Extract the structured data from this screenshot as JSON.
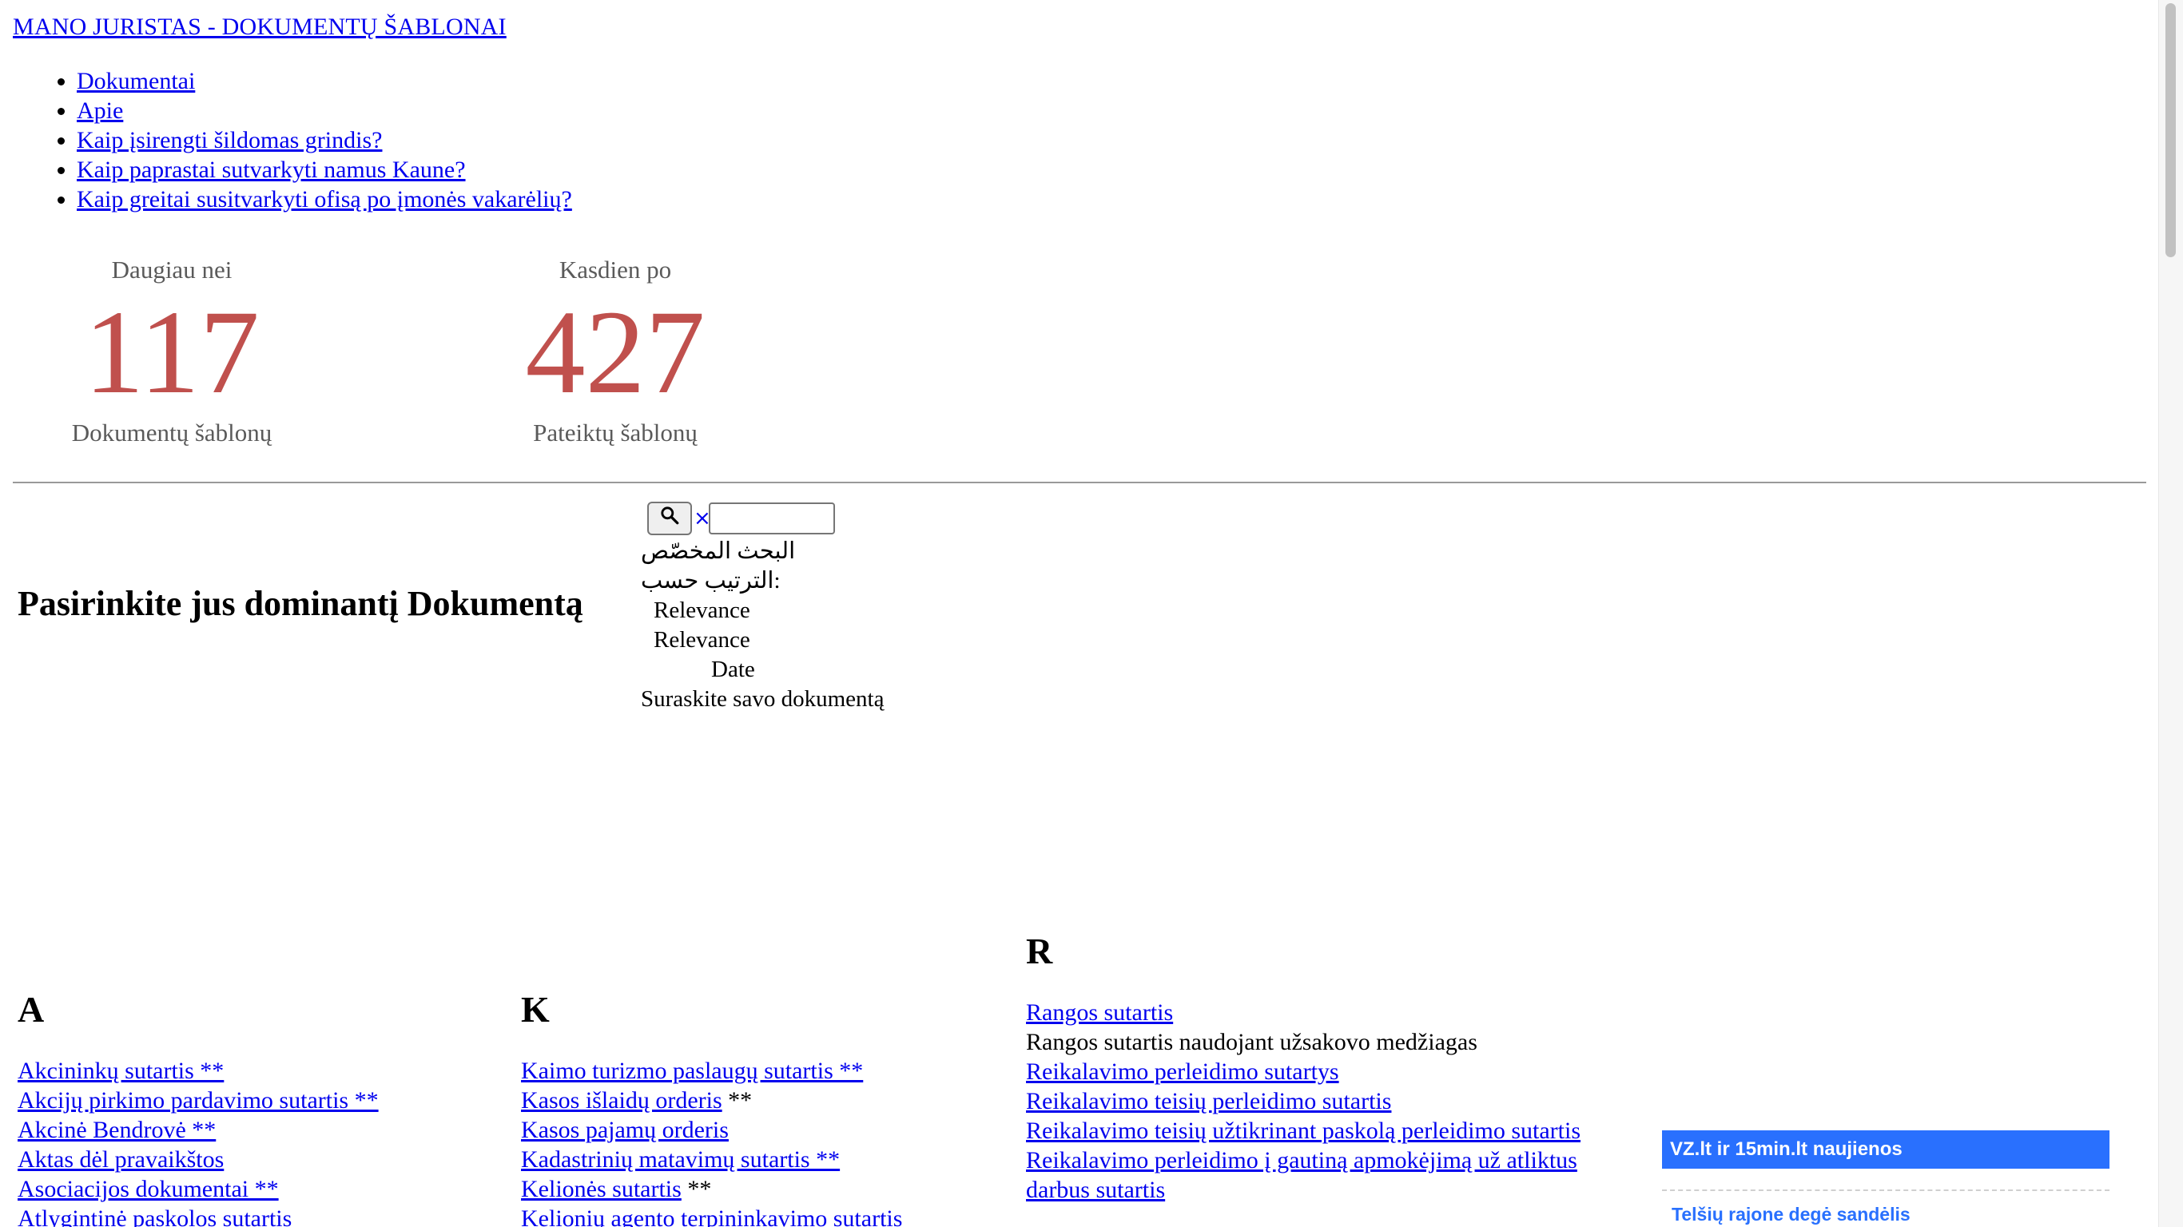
{
  "site": {
    "title": "MANO JURISTAS - DOKUMENTŲ ŠABLONAI"
  },
  "nav": {
    "items": [
      "Dokumentai",
      "Apie",
      "Kaip įsirengti šildomas grindis?",
      "Kaip paprastai sutvarkyti namus Kaune?",
      "Kaip greitai susitvarkyti ofisą po įmonės vakarėlių?"
    ]
  },
  "stats": {
    "left": {
      "top": "Daugiau nei",
      "number": "117",
      "bottom": "Dokumentų šablonų"
    },
    "right": {
      "top": "Kasdien po",
      "number": "427",
      "bottom": "Pateiktų šablonų"
    }
  },
  "page": {
    "heading": "Pasirinkite jus dominantį Dokumentą"
  },
  "search": {
    "clear_label": "×",
    "input_value": "",
    "custom_search": "البحث المخصّص",
    "sort_by": "الترتيب حسب:",
    "options": [
      "Relevance",
      "Relevance",
      "Date"
    ],
    "find_label": "Suraskite savo dokumentą",
    "icon": "search-icon"
  },
  "sections": {
    "a": {
      "letter": "A",
      "items": [
        {
          "link": "Akcininkų sutartis **",
          "suffix": ""
        },
        {
          "link": "Akcijų pirkimo pardavimo sutartis **",
          "suffix": ""
        },
        {
          "link": "Akcinė Bendrovė **",
          "suffix": ""
        },
        {
          "link": "Aktas dėl pravaikštos",
          "suffix": ""
        },
        {
          "link": "Asociacijos dokumentai **",
          "suffix": ""
        },
        {
          "link": "Atlygintinė paskolos sutartis",
          "suffix": ""
        }
      ]
    },
    "k": {
      "letter": "K",
      "items": [
        {
          "link": "Kaimo turizmo paslaugų sutartis **",
          "suffix": ""
        },
        {
          "link": "Kasos išlaidų orderis",
          "suffix": " **"
        },
        {
          "link": "Kasos pajamų orderis",
          "suffix": ""
        },
        {
          "link": "Kadastrinių matavimų sutartis **",
          "suffix": ""
        },
        {
          "link": "Kelionės sutartis",
          "suffix": " **"
        },
        {
          "link": "Kelionių agento terpininkavimo sutartis",
          "suffix": ""
        }
      ]
    },
    "r": {
      "letter": "R",
      "items": [
        {
          "link": "Rangos sutartis",
          "plain": ""
        },
        {
          "link": "",
          "plain": "Rangos sutartis naudojant užsakovo medžiagas"
        },
        {
          "link": "Reikalavimo perleidimo sutartys",
          "plain": ""
        },
        {
          "link": "Reikalavimo teisių perleidimo sutartis",
          "plain": ""
        },
        {
          "link": "Reikalavimo teisių užtikrinant paskolą perleidimo sutartis",
          "plain": ""
        },
        {
          "link": "Reikalavimo perleidimo į gautiną apmokėjimą už atliktus darbus sutartis",
          "plain": ""
        }
      ]
    }
  },
  "news": {
    "header": "VZ.lt ir 15min.lt naujienos",
    "items": [
      "Telšių rajone degė sandėlis"
    ]
  },
  "colors": {
    "link": "#0000ee",
    "stat_number": "#c0504d",
    "news_accent": "#2970fe"
  }
}
